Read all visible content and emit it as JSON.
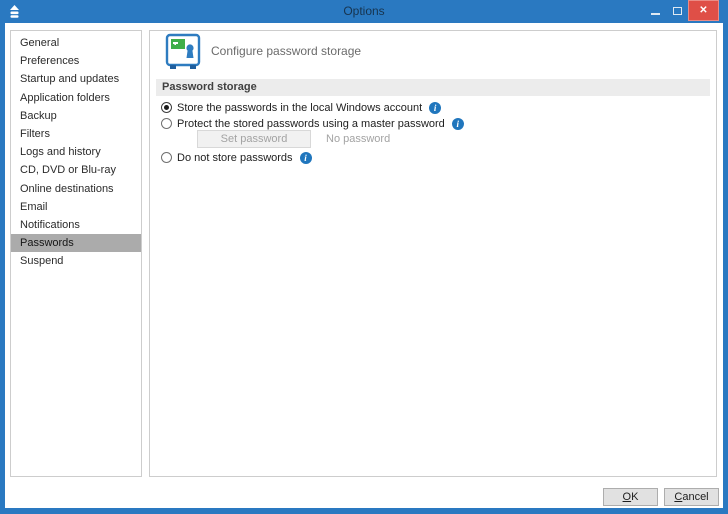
{
  "window": {
    "title": "Options",
    "close_glyph": "✕"
  },
  "sidebar": {
    "items": [
      "General",
      "Preferences",
      "Startup and updates",
      "Application folders",
      "Backup",
      "Filters",
      "Logs and history",
      "CD, DVD or Blu-ray",
      "Online destinations",
      "Email",
      "Notifications",
      "Passwords",
      "Suspend"
    ],
    "selected_index": 11
  },
  "main": {
    "header_title": "Configure password storage",
    "section_title": "Password storage",
    "options": [
      {
        "label": "Store the passwords in the local Windows account",
        "selected": true
      },
      {
        "label": "Protect the stored passwords using a master password",
        "selected": false
      },
      {
        "label": "Do not store passwords",
        "selected": false
      }
    ],
    "info_glyph": "i",
    "set_password_label": "Set password",
    "password_status": "No password"
  },
  "footer": {
    "ok": {
      "key": "O",
      "rest": "K"
    },
    "cancel": {
      "key": "C",
      "rest": "ancel"
    }
  },
  "colors": {
    "titlebar_blue": "#2a79c1",
    "close_red": "#df4f47",
    "selected_item_gray": "#ababab",
    "section_header_gray": "#ececec",
    "info_icon_blue": "#2076bd"
  }
}
